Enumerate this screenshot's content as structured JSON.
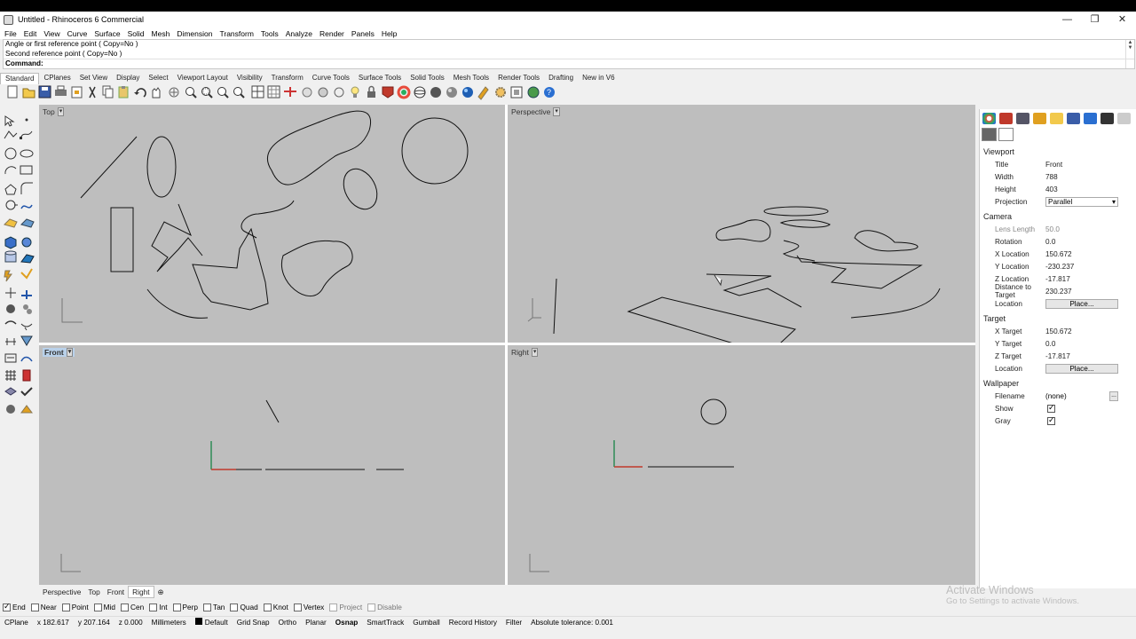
{
  "window": {
    "title": "Untitled - Rhinoceros 6 Commercial",
    "min": "—",
    "max": "❐",
    "close": "✕"
  },
  "menu": [
    "File",
    "Edit",
    "View",
    "Curve",
    "Surface",
    "Solid",
    "Mesh",
    "Dimension",
    "Transform",
    "Tools",
    "Analyze",
    "Render",
    "Panels",
    "Help"
  ],
  "command": {
    "lines": [
      "Angle or first reference point ( Copy=No )",
      "Second reference point ( Copy=No )"
    ],
    "prompt": "Command:"
  },
  "tabs": [
    "Standard",
    "CPlanes",
    "Set View",
    "Display",
    "Select",
    "Viewport Layout",
    "Visibility",
    "Transform",
    "Curve Tools",
    "Surface Tools",
    "Solid Tools",
    "Mesh Tools",
    "Render Tools",
    "Drafting",
    "New in V6"
  ],
  "viewports": {
    "top": "Top",
    "perspective": "Perspective",
    "front": "Front",
    "right": "Right"
  },
  "viewport_tabs": [
    "Perspective",
    "Top",
    "Front",
    "Right"
  ],
  "panel": {
    "viewport_header": "Viewport",
    "title_k": "Title",
    "title_v": "Front",
    "width_k": "Width",
    "width_v": "788",
    "height_k": "Height",
    "height_v": "403",
    "proj_k": "Projection",
    "proj_v": "Parallel",
    "camera_header": "Camera",
    "lens_k": "Lens Length",
    "lens_v": "50.0",
    "rot_k": "Rotation",
    "rot_v": "0.0",
    "xloc_k": "X Location",
    "xloc_v": "150.672",
    "yloc_k": "Y Location",
    "yloc_v": "-230.237",
    "zloc_k": "Z Location",
    "zloc_v": "-17.817",
    "dist_k": "Distance to Target",
    "dist_v": "230.237",
    "loc_k": "Location",
    "place": "Place...",
    "target_header": "Target",
    "xt_k": "X Target",
    "xt_v": "150.672",
    "yt_k": "Y Target",
    "yt_v": "0.0",
    "zt_k": "Z Target",
    "zt_v": "-17.817",
    "tloc_k": "Location",
    "wall_header": "Wallpaper",
    "file_k": "Filename",
    "file_v": "(none)",
    "dots": "...",
    "show_k": "Show",
    "gray_k": "Gray"
  },
  "osnap": [
    {
      "label": "End",
      "on": true
    },
    {
      "label": "Near",
      "on": false
    },
    {
      "label": "Point",
      "on": false
    },
    {
      "label": "Mid",
      "on": false
    },
    {
      "label": "Cen",
      "on": false
    },
    {
      "label": "Int",
      "on": false
    },
    {
      "label": "Perp",
      "on": false
    },
    {
      "label": "Tan",
      "on": false
    },
    {
      "label": "Quad",
      "on": false
    },
    {
      "label": "Knot",
      "on": false
    },
    {
      "label": "Vertex",
      "on": false
    },
    {
      "label": "Project",
      "on": false
    },
    {
      "label": "Disable",
      "on": false
    }
  ],
  "status": {
    "cplane": "CPlane",
    "x": "x 182.617",
    "y": "y 207.164",
    "z": "z 0.000",
    "units": "Millimeters",
    "layer": "Default",
    "grid": "Grid Snap",
    "ortho": "Ortho",
    "planar": "Planar",
    "osnap": "Osnap",
    "smart": "SmartTrack",
    "gumball": "Gumball",
    "history": "Record History",
    "filter": "Filter",
    "tol": "Absolute tolerance: 0.001"
  },
  "watermark": {
    "line1": "Activate Windows",
    "line2": "Go to Settings to activate Windows."
  },
  "colors": {
    "viewport_bg": "#bebebe",
    "x_axis": "#c0392b",
    "y_axis": "#2e8b57",
    "z_axis": "#2e8b57"
  }
}
